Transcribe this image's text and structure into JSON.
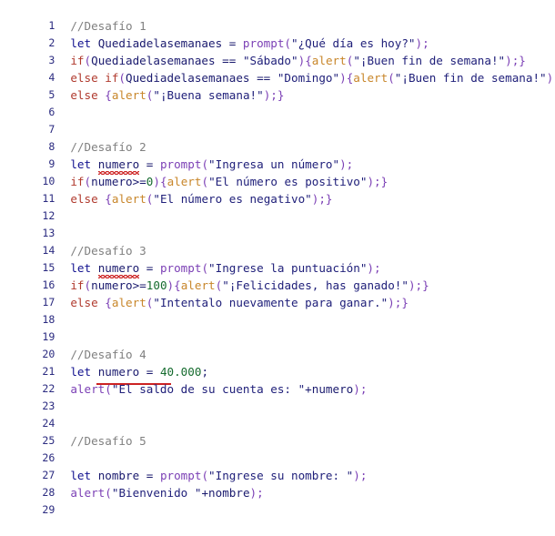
{
  "editor": {
    "language": "javascript",
    "total_lines": 29,
    "background_color": "#ffffff",
    "gutter_color": "#2b2b80",
    "colors": {
      "comment": "#808080",
      "keyword_let": "#11118f",
      "keyword_control": "#b03a2e",
      "function_prompt": "#7b3fb5",
      "function_alert": "#c8862a",
      "string": "#20207a",
      "number": "#156b2e",
      "variable": "#1a1a6e",
      "spellcheck_squiggle": "#cc2222",
      "error_underline": "#cc2222"
    },
    "lines": [
      {
        "n": "1",
        "text": "//Desafío 1"
      },
      {
        "n": "2",
        "text": "let Quediadelasemanaes = prompt(\"¿Qué día es hoy?\");"
      },
      {
        "n": "3",
        "text": "if(Quediadelasemanaes == \"Sábado\"){alert(\"¡Buen fin de semana!\");}"
      },
      {
        "n": "4",
        "text": "else if(Quediadelasemanaes == \"Domingo\"){alert(\"¡Buen fin de semana!\");}"
      },
      {
        "n": "5",
        "text": "else {alert(\"¡Buena semana!\");}"
      },
      {
        "n": "6",
        "text": ""
      },
      {
        "n": "7",
        "text": ""
      },
      {
        "n": "8",
        "text": "//Desafío 2"
      },
      {
        "n": "9",
        "text": "let numero = prompt(\"Ingresa un número\");"
      },
      {
        "n": "10",
        "text": "if(numero>=0){alert(\"El número es positivo\");}"
      },
      {
        "n": "11",
        "text": "else {alert(\"El número es negativo\");}"
      },
      {
        "n": "12",
        "text": ""
      },
      {
        "n": "13",
        "text": ""
      },
      {
        "n": "14",
        "text": "//Desafío 3"
      },
      {
        "n": "15",
        "text": "let numero = prompt(\"Ingrese la puntuación\");"
      },
      {
        "n": "16",
        "text": "if(numero>=100){alert(\"¡Felicidades, has ganado!\");}"
      },
      {
        "n": "17",
        "text": "else {alert(\"Intentalo nuevamente para ganar.\");}"
      },
      {
        "n": "18",
        "text": ""
      },
      {
        "n": "19",
        "text": ""
      },
      {
        "n": "20",
        "text": "//Desafío 4"
      },
      {
        "n": "21",
        "text": "let numero = 40.000;"
      },
      {
        "n": "22",
        "text": "alert(\"El saldo de su cuenta es: \"+numero);"
      },
      {
        "n": "23",
        "text": ""
      },
      {
        "n": "24",
        "text": ""
      },
      {
        "n": "25",
        "text": "//Desafío 5"
      },
      {
        "n": "26",
        "text": ""
      },
      {
        "n": "27",
        "text": "let nombre = prompt(\"Ingrese su nombre: \");"
      },
      {
        "n": "28",
        "text": "alert(\"Bienvenido \"+nombre);"
      },
      {
        "n": "29",
        "text": ""
      }
    ],
    "tokens": {
      "comment_1": "//Desafío 1",
      "comment_2": "//Desafío 2",
      "comment_3": "//Desafío 3",
      "comment_4": "//Desafío 4",
      "comment_5": "//Desafío 5",
      "kw_let": "let ",
      "kw_if": "if",
      "kw_else": "else ",
      "kw_else_if": "else if",
      "fn_prompt": "prompt",
      "fn_alert": "alert",
      "var_dia": "Quediadelasemanaes",
      "var_numero": "numero",
      "var_nombre": "nombre",
      "str_que_dia": "\"¿Qué día es hoy?\"",
      "str_sabado": "\"Sábado\"",
      "str_domingo": "\"Domingo\"",
      "str_buen_fin": "\"¡Buen fin de semana!\"",
      "str_buena_semana": "\"¡Buena semana!\"",
      "str_ingresa_numero": "\"Ingresa un número\"",
      "str_positivo": "\"El número es positivo\"",
      "str_negativo": "\"El número es negativo\"",
      "str_puntuacion": "\"Ingrese la puntuación\"",
      "str_felicidades": "\"¡Felicidades, has ganado!\"",
      "str_intentalo": "\"Intentalo nuevamente para ganar.\"",
      "str_saldo": "\"El saldo de su cuenta es: \"",
      "str_ingrese_nombre": "\"Ingrese su nombre: \"",
      "str_bienvenido": "\"Bienvenido \"",
      "num_zero": "0",
      "num_cien": "100",
      "num_saldo": "40.000",
      "op_assign": " = ",
      "op_eq": " == ",
      "op_gte": ">=",
      "op_concat": "+",
      "p_open": "(",
      "p_close": ")",
      "b_open": "{",
      "b_close": "}",
      "semi": ";",
      "semi_brace": ");}",
      "close_stmt": ");"
    }
  }
}
